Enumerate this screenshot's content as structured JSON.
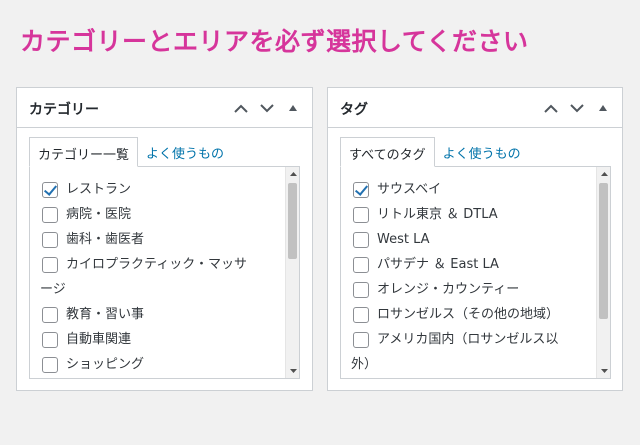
{
  "headline": "カテゴリーとエリアを必ず選択してください",
  "category_panel": {
    "title": "カテゴリー",
    "tabs": [
      "カテゴリー一覧",
      "よく使うもの"
    ],
    "items": [
      {
        "label": "レストラン",
        "checked": true
      },
      {
        "label": "病院・医院",
        "checked": false
      },
      {
        "label": "歯科・歯医者",
        "checked": false
      },
      {
        "label_line1": "カイロプラクティック・マッサ",
        "label_line2": "ージ",
        "checked": false
      },
      {
        "label": "教育・習い事",
        "checked": false
      },
      {
        "label": "自動車関連",
        "checked": false
      },
      {
        "label": "ショッピング",
        "checked": false
      }
    ]
  },
  "tag_panel": {
    "title": "タグ",
    "tabs": [
      "すべてのタグ",
      "よく使うもの"
    ],
    "items": [
      {
        "label": "サウスベイ",
        "checked": true
      },
      {
        "label": "リトル東京 ＆ DTLA",
        "checked": false
      },
      {
        "label": "West LA",
        "checked": false
      },
      {
        "label": "パサデナ ＆ East LA",
        "checked": false
      },
      {
        "label": "オレンジ・カウンティー",
        "checked": false
      },
      {
        "label": "ロサンゼルス（その他の地域）",
        "checked": false
      },
      {
        "label_line1": "アメリカ国内（ロサンゼルス以",
        "label_line2": "外）",
        "checked": false
      }
    ]
  },
  "colors": {
    "headline": "#d6359b",
    "link": "#0073aa",
    "check": "#2271b1"
  }
}
